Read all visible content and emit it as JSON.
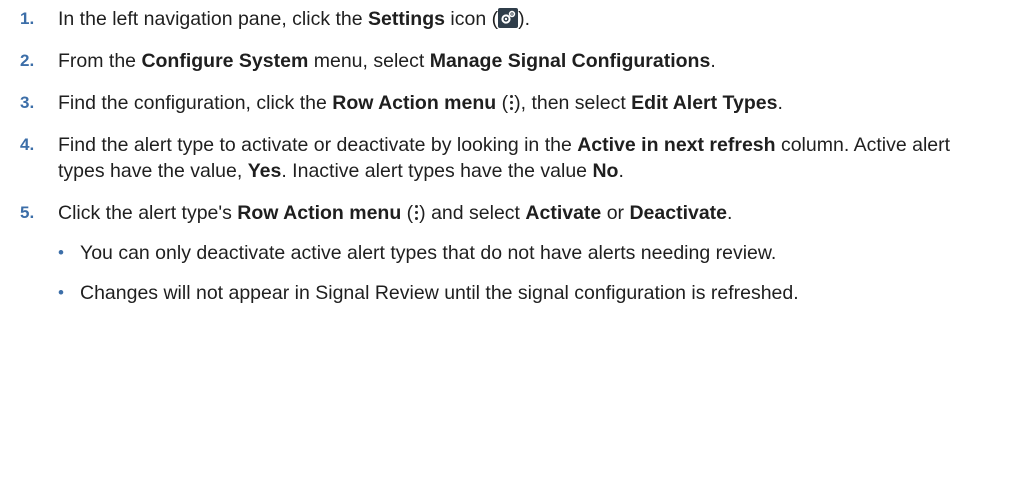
{
  "steps": [
    {
      "num": "1.",
      "t1": "In the left navigation pane, click the ",
      "b1": "Settings",
      "t2": " icon (",
      "icon": "settings-gear-icon",
      "t3": ")."
    },
    {
      "num": "2.",
      "t1": "From the ",
      "b1": "Configure System",
      "t2": " menu, select ",
      "b2": "Manage Signal Configurations",
      "t3": "."
    },
    {
      "num": "3.",
      "t1": "Find the configuration, click the ",
      "b1": "Row Action menu",
      "t2": " (",
      "icon": "kebab-menu-icon",
      "t3": "), then select ",
      "b2": "Edit Alert Types",
      "t4": "."
    },
    {
      "num": "4.",
      "t1": "Find the alert type to activate or deactivate by looking in the ",
      "b1": "Active in next refresh",
      "t2": " column. Active alert types have the value, ",
      "b2": "Yes",
      "t3": ". Inactive alert types have the value ",
      "b3": "No",
      "t4": "."
    },
    {
      "num": "5.",
      "t1": "Click the alert type's ",
      "b1": "Row Action menu",
      "t2": " (",
      "icon": "kebab-menu-icon",
      "t3": ") and select ",
      "b2": "Activate",
      "t4": " or ",
      "b3": "Deactivate",
      "t5": ".",
      "bullets": [
        "You can only deactivate active alert types that do not have alerts needing review.",
        "Changes will not appear in Signal Review until the signal configuration is refreshed."
      ]
    }
  ]
}
